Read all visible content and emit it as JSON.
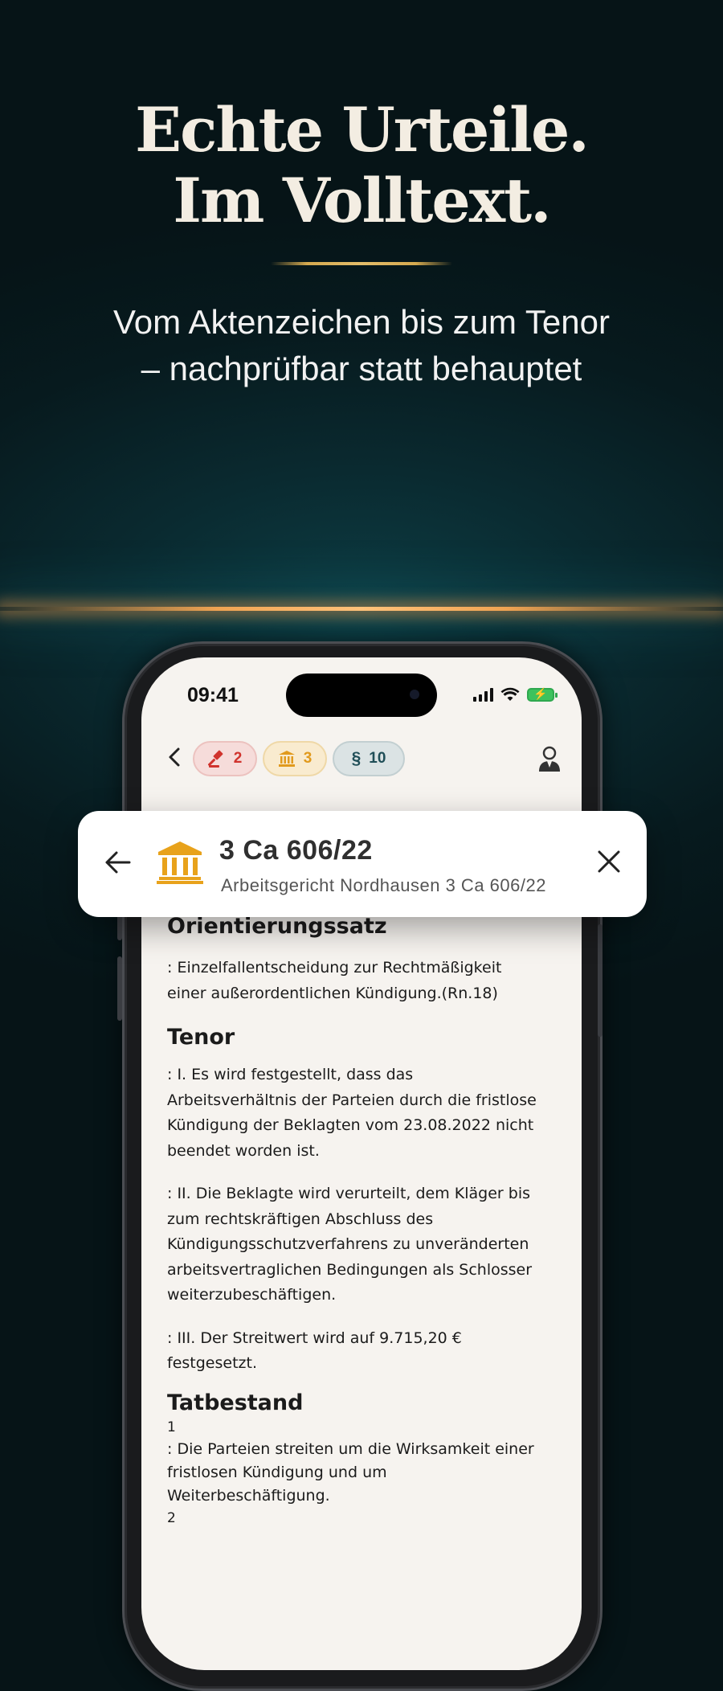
{
  "hero": {
    "headline_line1": "Echte Urteile.",
    "headline_line2": "Im Volltext.",
    "subline_line1": "Vom Aktenzeichen bis zum Tenor",
    "subline_line2": "– nachprüfbar statt behauptet"
  },
  "status_bar": {
    "time": "09:41"
  },
  "app_bar": {
    "back_icon": "chevron-left-icon",
    "filters": [
      {
        "icon": "gavel-icon",
        "count": "2",
        "color": "#d0332d"
      },
      {
        "icon": "court-building-icon",
        "count": "3",
        "color": "#e19a1d"
      },
      {
        "icon": "section-sign-icon",
        "symbol": "§",
        "count": "10",
        "color": "#1f4e57"
      }
    ],
    "profile_icon": "lawyer-avatar-icon"
  },
  "case_card": {
    "case_number": "3 Ca 606/22",
    "court": "Arbeitsgericht Nordhausen 3 Ca 606/22",
    "back_icon": "arrow-left-icon",
    "court_icon": "court-building-icon",
    "close_icon": "close-icon",
    "accent_color": "#e8a21b"
  },
  "document": {
    "orientierungssatz_heading": "Orientierungssatz",
    "orientierungssatz_line1": ":   Einzelfallentscheidung zur Rechtmäßigkeit",
    "orientierungssatz_line2": "einer außerordentlichen Kündigung.(Rn.18)",
    "tenor_heading": "Tenor",
    "tenor_1_lines": [
      ":   I. Es wird festgestellt, dass das",
      "Arbeitsverhältnis der Parteien durch die fristlose",
      "Kündigung der Beklagten vom 23.08.2022 nicht",
      "beendet worden ist."
    ],
    "tenor_2_lines": [
      ":   II. Die Beklagte wird verurteilt, dem Kläger bis",
      "zum rechtskräftigen Abschluss des",
      "Kündigungsschutzverfahrens zu unveränderten",
      "arbeitsvertraglichen Bedingungen als Schlosser",
      "weiterzubeschäftigen."
    ],
    "tenor_3_lines": [
      ":   III. Der Streitwert wird auf 9.715,20 €",
      "festgesetzt."
    ],
    "tatbestand_heading": "Tatbestand",
    "tatbestand_n1": "1",
    "tatbestand_1_lines": [
      ":   Die Parteien streiten um die Wirksamkeit einer",
      "fristlosen Kündigung und um",
      "Weiterbeschäftigung."
    ],
    "tatbestand_n2": "2"
  }
}
